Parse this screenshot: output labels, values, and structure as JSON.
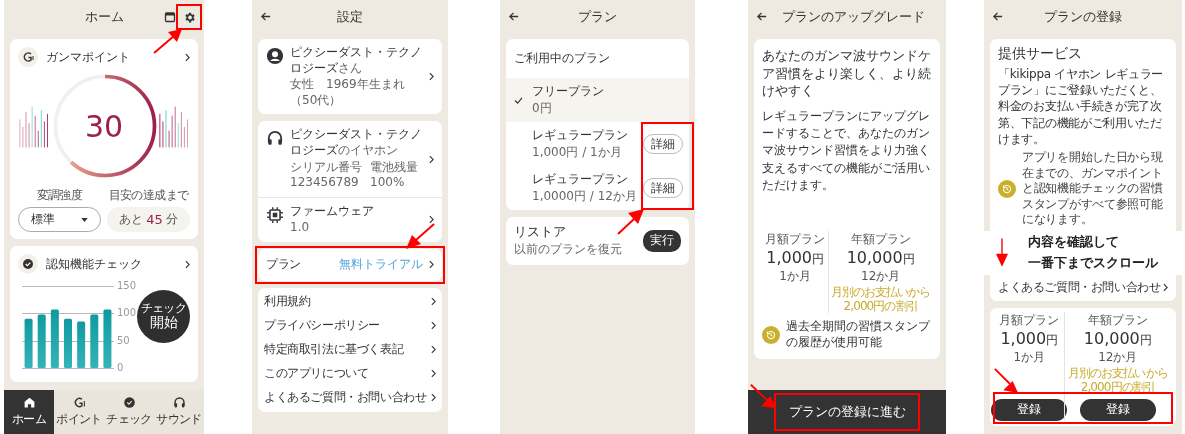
{
  "home": {
    "title": "ホーム",
    "gamma": {
      "title": "ガンマポイント",
      "value": "30",
      "level": 0.62,
      "intensity_label": "変調強度",
      "intensity": "標準",
      "goal_label": "目安の達成まで",
      "goal_prefix": "あと",
      "goal_value": "45",
      "goal_unit": "分"
    },
    "cognitive": {
      "title": "認知機能チェック",
      "check_small": "チェック",
      "check_big": "開始",
      "chart_data": {
        "type": "bar",
        "categories": [
          null,
          null,
          null,
          null,
          null,
          null,
          null
        ],
        "values": [
          90,
          98,
          107,
          90,
          85,
          98,
          107
        ],
        "ylim": [
          0,
          150
        ],
        "yticks": [
          0,
          50,
          100,
          150
        ],
        "grid": true
      }
    },
    "nav": [
      {
        "label": "ホーム",
        "selected": true
      },
      {
        "label": "ポイント",
        "selected": false
      },
      {
        "label": "チェック",
        "selected": false
      },
      {
        "label": "サウンド",
        "selected": false
      }
    ]
  },
  "settings": {
    "title": "設定",
    "profile": {
      "name": "ピクシーダスト・テクノロジーズ",
      "suffix": "さん",
      "detail": "女性　1969年生まれ（50代）"
    },
    "earphone": {
      "name": "ピクシーダスト・テクノロジーズ",
      "suffix": "のイヤホン",
      "serial_label": "シリアル番号",
      "battery_label": "電池残量",
      "serial": "123456789",
      "battery": "100%"
    },
    "firmware": {
      "label": "ファームウェア",
      "version": "1.0"
    },
    "plan": {
      "label": "プラン",
      "value": "無料トライアル"
    },
    "links": [
      "利用規約",
      "プライバシーポリシー",
      "特定商取引法に基づく表記",
      "このアプリについて",
      "よくあるご質問・お問い合わせ"
    ]
  },
  "plans": {
    "title": "プラン",
    "current_label": "ご利用中のプラン",
    "options": [
      {
        "name": "フリープラン",
        "price": "0円",
        "selected": true
      },
      {
        "name": "レギュラープラン",
        "price": "1,000円 / 1か月",
        "button": "詳細",
        "selected": false
      },
      {
        "name": "レギュラープラン",
        "price": "1,0000円 / 12か月",
        "button": "詳細",
        "selected": false
      }
    ],
    "restore": {
      "title": "リストア",
      "subtitle": "以前のプランを復元",
      "button": "実行"
    }
  },
  "upgrade": {
    "title": "プランのアップグレード",
    "headline": "あなたのガンマ波サウンドケア習慣をより楽しく、より続けやすく",
    "body": "レギュラープランにアップグレードすることで、あなたのガンマ波サウンド習慣をより力強く支えるすべての機能がご活用いただけます。",
    "prices": [
      {
        "label": "月額プラン",
        "amount": "1,000",
        "unit": "円",
        "period": "1か月"
      },
      {
        "label": "年額プラン",
        "amount": "10,000",
        "unit": "円",
        "period": "12か月",
        "note": "月別のお支払いから2,000円の割引"
      }
    ],
    "feature": "過去全期間の習慣スタンプの履歴が使用可能",
    "cta": "プランの登録に進む"
  },
  "register": {
    "title": "プランの登録",
    "section": "提供サービス",
    "intro": "「kikippa イヤホン レギュラープラン」にご登録いただくと、料金のお支払い手続きが完了次第、下記の機能がご利用いただけます。",
    "feature": "アプリを開始した日から現在までの、ガンマポイントと認知機能チェックの習慣スタンプがすべて参照可能になります。",
    "annotation": [
      "内容を確認して",
      "一番下までスクロール"
    ],
    "faq": "よくあるご質問・お問い合わせ",
    "prices": [
      {
        "label": "月額プラン",
        "amount": "1,000",
        "unit": "円",
        "period": "1か月",
        "button": "登録"
      },
      {
        "label": "年額プラン",
        "amount": "10,000",
        "unit": "円",
        "period": "12か月",
        "note": "月別のお支払いから2,000円の割引",
        "button": "登録"
      }
    ]
  }
}
